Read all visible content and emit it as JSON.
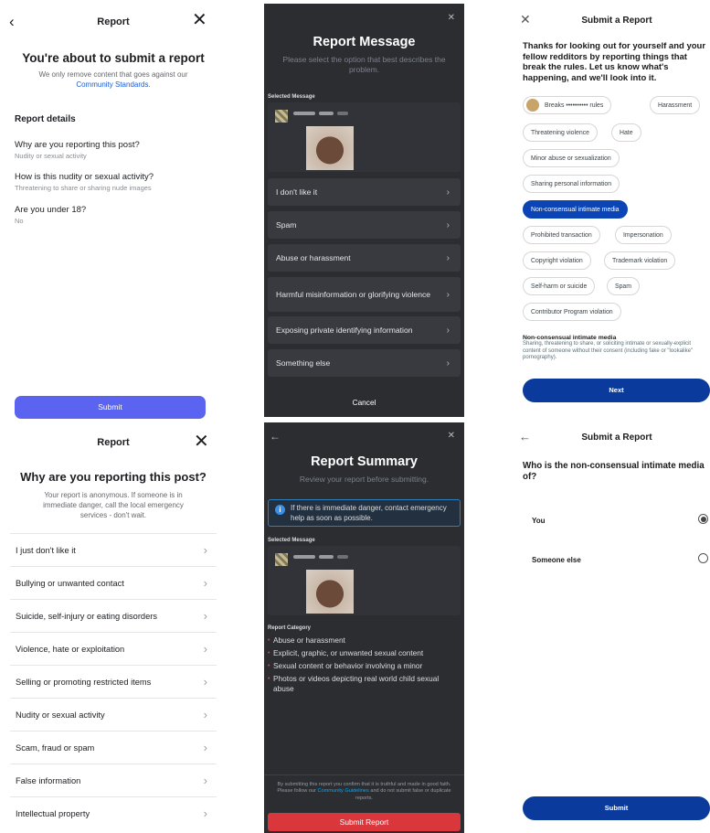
{
  "ig_top": {
    "header_title": "Report",
    "title": "You're about to submit a report",
    "subtitle_line1": "We only remove content that goes against our",
    "subtitle_link": "Community Standards.",
    "section_title": "Report details",
    "details": [
      {
        "q": "Why are you reporting this post?",
        "a": "Nudity or sexual activity"
      },
      {
        "q": "How is this nudity or sexual activity?",
        "a": "Threatening to share or sharing nude images"
      },
      {
        "q": "Are you under 18?",
        "a": "No"
      }
    ],
    "submit_label": "Submit"
  },
  "ig_bottom": {
    "header_title": "Report",
    "title": "Why are you reporting this post?",
    "subtitle": "Your report is anonymous. If someone is in immediate danger, call the local emergency services - don't wait.",
    "items": [
      "I just don't like it",
      "Bullying or unwanted contact",
      "Suicide, self-injury or eating disorders",
      "Violence, hate or exploitation",
      "Selling or promoting restricted items",
      "Nudity or sexual activity",
      "Scam, fraud or spam",
      "False information",
      "Intellectual property"
    ]
  },
  "dc_top": {
    "title": "Report Message",
    "subtitle": "Please select the option that best describes the problem.",
    "selected_label": "Selected Message",
    "options": [
      "I don't like it",
      "Spam",
      "Abuse or harassment",
      "Harmful misinformation or glorifying violence",
      "Exposing private identifying information",
      "Something else"
    ],
    "cancel_label": "Cancel"
  },
  "dc_bottom": {
    "title": "Report Summary",
    "subtitle": "Review your report before submitting.",
    "info": "If there is immediate danger, contact emergency help as soon as possible.",
    "selected_label": "Selected Message",
    "category_label": "Report Category",
    "categories": [
      "Abuse or harassment",
      "Explicit, graphic, or unwanted sexual content",
      "Sexual content or behavior involving a minor",
      "Photos or videos depicting real world child sexual abuse"
    ],
    "footer_pre": "By submitting this report you confirm that it is truthful and made in good faith. Please follow our ",
    "footer_link": "Community Guidelines",
    "footer_post": " and do not submit false or duplicate reports.",
    "submit_label": "Submit Report"
  },
  "rd_top": {
    "header_title": "Submit a Report",
    "intro": "Thanks for looking out for yourself and your fellow redditors by reporting things that break the rules. Let us know what's happening, and we'll look into it.",
    "pills": [
      "Breaks •••••••••• rules",
      "Harassment",
      "Threatening violence",
      "Hate",
      "Minor abuse or sexualization",
      "Sharing personal information",
      "Non-consensual intimate media",
      "Prohibited transaction",
      "Impersonation",
      "Copyright violation",
      "Trademark violation",
      "Self-harm or suicide",
      "Spam",
      "Contributor Program violation"
    ],
    "selected_pill": "Non-consensual intimate media",
    "desc_title": "Non-consensual intimate media",
    "desc": "Sharing, threatening to share, or soliciting intimate or sexually-explicit content of someone without their consent (including fake or \"lookalike\" pornography).",
    "next_label": "Next"
  },
  "rd_bottom": {
    "header_title": "Submit a Report",
    "question": "Who is the non-consensual intimate media of?",
    "options": [
      "You",
      "Someone else"
    ],
    "selected": "You",
    "submit_label": "Submit"
  },
  "colors": {
    "ig_button": "#5a64f0",
    "discord_bg": "#2b2d31",
    "discord_red": "#da373c",
    "reddit_blue": "#0a3a9c"
  }
}
